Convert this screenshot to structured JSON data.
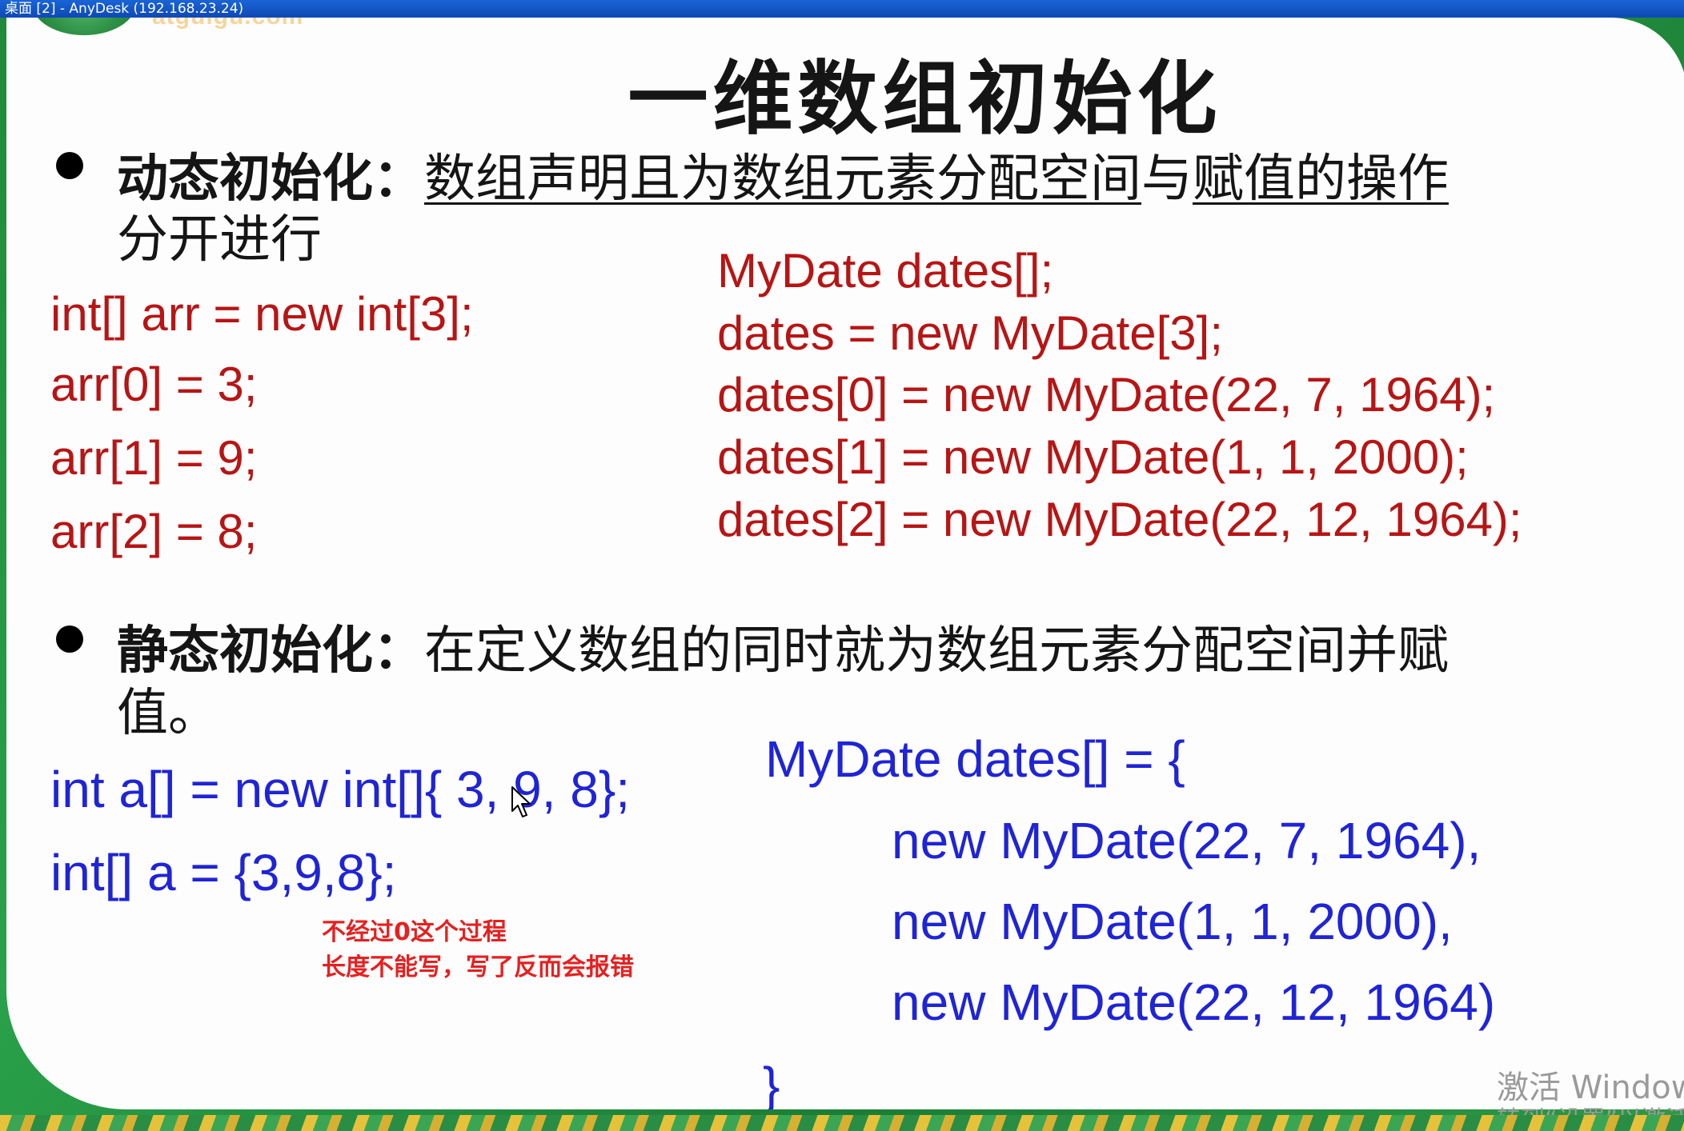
{
  "window": {
    "title": "桌面 [2] - AnyDesk (192.168.23.24)"
  },
  "logo": {
    "text": "atguigu.com"
  },
  "slide": {
    "title": "一维数组初始化",
    "dynamic": {
      "term": "动态初始化：",
      "desc_underlined_1": "数组声明且为数组元素分配空间",
      "desc_plain": "与",
      "desc_underlined_2": "赋值的操作",
      "desc_continued": "分开进行",
      "code_left": [
        "int[] arr = new int[3];",
        "arr[0] = 3;",
        "arr[1] = 9;",
        "arr[2] = 8;"
      ],
      "code_right": [
        "MyDate dates[];",
        "dates = new MyDate[3];",
        "dates[0] = new MyDate(22, 7, 1964);",
        "dates[1] = new MyDate(1, 1, 2000);",
        "dates[2] = new MyDate(22, 12, 1964);"
      ]
    },
    "static": {
      "term": "静态初始化：",
      "desc": "在定义数组的同时就为数组元素分配空间并赋",
      "desc_continued": "值。",
      "code_left": [
        "int a[] = new int[]{ 3, 9, 8};",
        "int[] a = {3,9,8};"
      ],
      "code_right": [
        "MyDate dates[] = {",
        "new MyDate(22, 7, 1964),",
        "new MyDate(1, 1, 2000),",
        "new MyDate(22, 12, 1964)",
        "}"
      ],
      "notes": [
        "不经过0这个过程",
        "长度不能写，写了反而会报错"
      ]
    }
  },
  "watermark": {
    "line1": "激活 Windows",
    "line2": "转到“设置”以激活"
  },
  "colors": {
    "code_red": "#b71515",
    "code_blue": "#1f24d6",
    "note_red": "#e62020",
    "background_green": "#2c8a3e",
    "titlebar_blue": "#1a64d6"
  },
  "icons": {
    "cursor": "mouse-pointer-icon",
    "bullet": "filled-circle-bullet"
  }
}
